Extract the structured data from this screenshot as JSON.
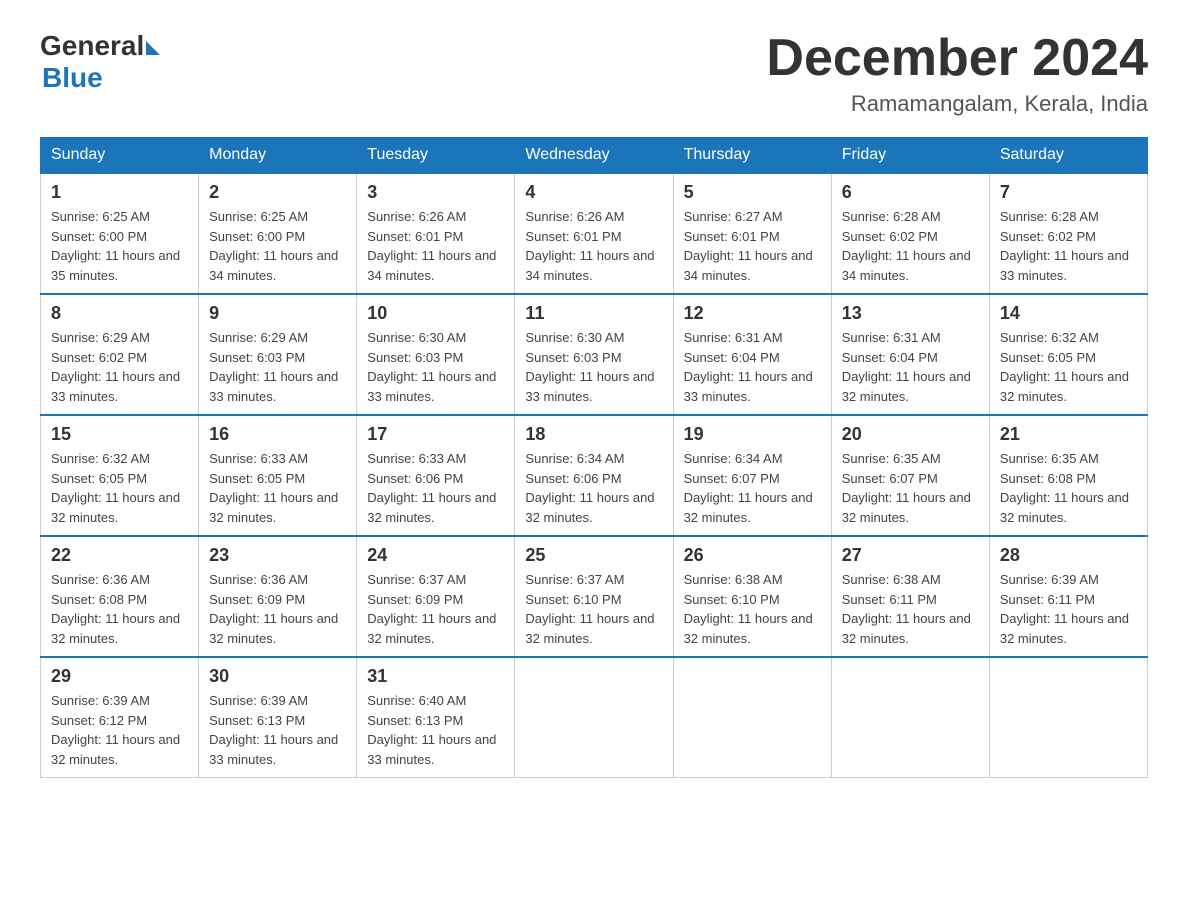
{
  "logo": {
    "general": "General",
    "blue": "Blue"
  },
  "title": "December 2024",
  "location": "Ramamangalam, Kerala, India",
  "days_of_week": [
    "Sunday",
    "Monday",
    "Tuesday",
    "Wednesday",
    "Thursday",
    "Friday",
    "Saturday"
  ],
  "weeks": [
    [
      {
        "day": "1",
        "sunrise": "6:25 AM",
        "sunset": "6:00 PM",
        "daylight": "11 hours and 35 minutes."
      },
      {
        "day": "2",
        "sunrise": "6:25 AM",
        "sunset": "6:00 PM",
        "daylight": "11 hours and 34 minutes."
      },
      {
        "day": "3",
        "sunrise": "6:26 AM",
        "sunset": "6:01 PM",
        "daylight": "11 hours and 34 minutes."
      },
      {
        "day": "4",
        "sunrise": "6:26 AM",
        "sunset": "6:01 PM",
        "daylight": "11 hours and 34 minutes."
      },
      {
        "day": "5",
        "sunrise": "6:27 AM",
        "sunset": "6:01 PM",
        "daylight": "11 hours and 34 minutes."
      },
      {
        "day": "6",
        "sunrise": "6:28 AM",
        "sunset": "6:02 PM",
        "daylight": "11 hours and 34 minutes."
      },
      {
        "day": "7",
        "sunrise": "6:28 AM",
        "sunset": "6:02 PM",
        "daylight": "11 hours and 33 minutes."
      }
    ],
    [
      {
        "day": "8",
        "sunrise": "6:29 AM",
        "sunset": "6:02 PM",
        "daylight": "11 hours and 33 minutes."
      },
      {
        "day": "9",
        "sunrise": "6:29 AM",
        "sunset": "6:03 PM",
        "daylight": "11 hours and 33 minutes."
      },
      {
        "day": "10",
        "sunrise": "6:30 AM",
        "sunset": "6:03 PM",
        "daylight": "11 hours and 33 minutes."
      },
      {
        "day": "11",
        "sunrise": "6:30 AM",
        "sunset": "6:03 PM",
        "daylight": "11 hours and 33 minutes."
      },
      {
        "day": "12",
        "sunrise": "6:31 AM",
        "sunset": "6:04 PM",
        "daylight": "11 hours and 33 minutes."
      },
      {
        "day": "13",
        "sunrise": "6:31 AM",
        "sunset": "6:04 PM",
        "daylight": "11 hours and 32 minutes."
      },
      {
        "day": "14",
        "sunrise": "6:32 AM",
        "sunset": "6:05 PM",
        "daylight": "11 hours and 32 minutes."
      }
    ],
    [
      {
        "day": "15",
        "sunrise": "6:32 AM",
        "sunset": "6:05 PM",
        "daylight": "11 hours and 32 minutes."
      },
      {
        "day": "16",
        "sunrise": "6:33 AM",
        "sunset": "6:05 PM",
        "daylight": "11 hours and 32 minutes."
      },
      {
        "day": "17",
        "sunrise": "6:33 AM",
        "sunset": "6:06 PM",
        "daylight": "11 hours and 32 minutes."
      },
      {
        "day": "18",
        "sunrise": "6:34 AM",
        "sunset": "6:06 PM",
        "daylight": "11 hours and 32 minutes."
      },
      {
        "day": "19",
        "sunrise": "6:34 AM",
        "sunset": "6:07 PM",
        "daylight": "11 hours and 32 minutes."
      },
      {
        "day": "20",
        "sunrise": "6:35 AM",
        "sunset": "6:07 PM",
        "daylight": "11 hours and 32 minutes."
      },
      {
        "day": "21",
        "sunrise": "6:35 AM",
        "sunset": "6:08 PM",
        "daylight": "11 hours and 32 minutes."
      }
    ],
    [
      {
        "day": "22",
        "sunrise": "6:36 AM",
        "sunset": "6:08 PM",
        "daylight": "11 hours and 32 minutes."
      },
      {
        "day": "23",
        "sunrise": "6:36 AM",
        "sunset": "6:09 PM",
        "daylight": "11 hours and 32 minutes."
      },
      {
        "day": "24",
        "sunrise": "6:37 AM",
        "sunset": "6:09 PM",
        "daylight": "11 hours and 32 minutes."
      },
      {
        "day": "25",
        "sunrise": "6:37 AM",
        "sunset": "6:10 PM",
        "daylight": "11 hours and 32 minutes."
      },
      {
        "day": "26",
        "sunrise": "6:38 AM",
        "sunset": "6:10 PM",
        "daylight": "11 hours and 32 minutes."
      },
      {
        "day": "27",
        "sunrise": "6:38 AM",
        "sunset": "6:11 PM",
        "daylight": "11 hours and 32 minutes."
      },
      {
        "day": "28",
        "sunrise": "6:39 AM",
        "sunset": "6:11 PM",
        "daylight": "11 hours and 32 minutes."
      }
    ],
    [
      {
        "day": "29",
        "sunrise": "6:39 AM",
        "sunset": "6:12 PM",
        "daylight": "11 hours and 32 minutes."
      },
      {
        "day": "30",
        "sunrise": "6:39 AM",
        "sunset": "6:13 PM",
        "daylight": "11 hours and 33 minutes."
      },
      {
        "day": "31",
        "sunrise": "6:40 AM",
        "sunset": "6:13 PM",
        "daylight": "11 hours and 33 minutes."
      },
      null,
      null,
      null,
      null
    ]
  ]
}
